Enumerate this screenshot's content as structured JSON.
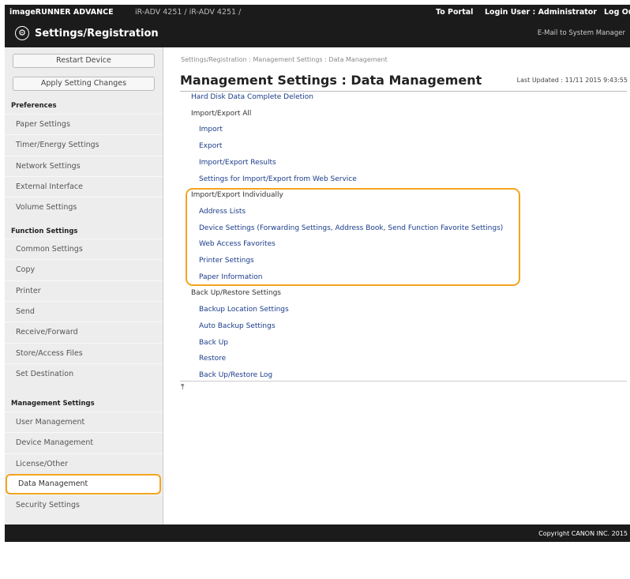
{
  "topbar": {
    "product": "imageRUNNER ADVANCE",
    "device_info": "iR-ADV 4251 / iR-ADV 4251 /",
    "to_portal": "To Portal",
    "login_user": "Login User :  Administrator",
    "logout": "Log Out"
  },
  "header": {
    "title": "Settings/Registration",
    "mail_link": "E-Mail to System Manager"
  },
  "sidebar": {
    "restart_button": "Restart Device",
    "apply_button": "Apply Setting Changes",
    "sections": [
      {
        "heading": "Preferences",
        "items": [
          "Paper Settings",
          "Timer/Energy Settings",
          "Network Settings",
          "External Interface",
          "Volume Settings"
        ]
      },
      {
        "heading": "Function Settings",
        "items": [
          "Common Settings",
          "Copy",
          "Printer",
          "Send",
          "Receive/Forward",
          "Store/Access Files",
          "Set Destination"
        ]
      },
      {
        "heading": "Management Settings",
        "items": [
          "User Management",
          "Device Management",
          "License/Other",
          "Data Management",
          "Security Settings"
        ]
      }
    ],
    "selected": "Data Management"
  },
  "main": {
    "breadcrumb": "Settings/Registration : Management Settings : Data Management",
    "page_title": "Management Settings : Data Management",
    "last_updated": "Last Updated : 11/11 2015 9:43:55",
    "rows": [
      {
        "text": "Hard Disk Data Complete Deletion",
        "type": "link",
        "level": 0
      },
      {
        "text": "Import/Export All",
        "type": "label",
        "level": 0
      },
      {
        "text": "Import",
        "type": "link",
        "level": 1
      },
      {
        "text": "Export",
        "type": "link",
        "level": 1
      },
      {
        "text": "Import/Export Results",
        "type": "link",
        "level": 1
      },
      {
        "text": "Settings for Import/Export from Web Service",
        "type": "link",
        "level": 1
      },
      {
        "text": "Import/Export Individually",
        "type": "label",
        "level": 0
      },
      {
        "text": "Address Lists",
        "type": "link",
        "level": 1
      },
      {
        "text": "Device Settings (Forwarding Settings, Address Book, Send Function Favorite Settings)",
        "type": "link",
        "level": 1
      },
      {
        "text": "Web Access Favorites",
        "type": "link",
        "level": 1
      },
      {
        "text": "Printer Settings",
        "type": "link",
        "level": 1
      },
      {
        "text": "Paper Information",
        "type": "link",
        "level": 1
      },
      {
        "text": "Back Up/Restore Settings",
        "type": "label",
        "level": 0
      },
      {
        "text": "Backup Location Settings",
        "type": "link",
        "level": 1
      },
      {
        "text": "Auto Backup Settings",
        "type": "link",
        "level": 1
      },
      {
        "text": "Back Up",
        "type": "link",
        "level": 1
      },
      {
        "text": "Restore",
        "type": "link",
        "level": 1
      },
      {
        "text": "Back Up/Restore Log",
        "type": "link",
        "level": 1
      }
    ],
    "top_icon": "scroll-to-top-icon"
  },
  "footer": {
    "copyright": "Copyright CANON INC. 2015"
  },
  "colors": {
    "bar": "#1b1b1b",
    "link": "#1a3c8a",
    "highlight": "#f3a41f",
    "sidebar_bg": "#ededed"
  }
}
